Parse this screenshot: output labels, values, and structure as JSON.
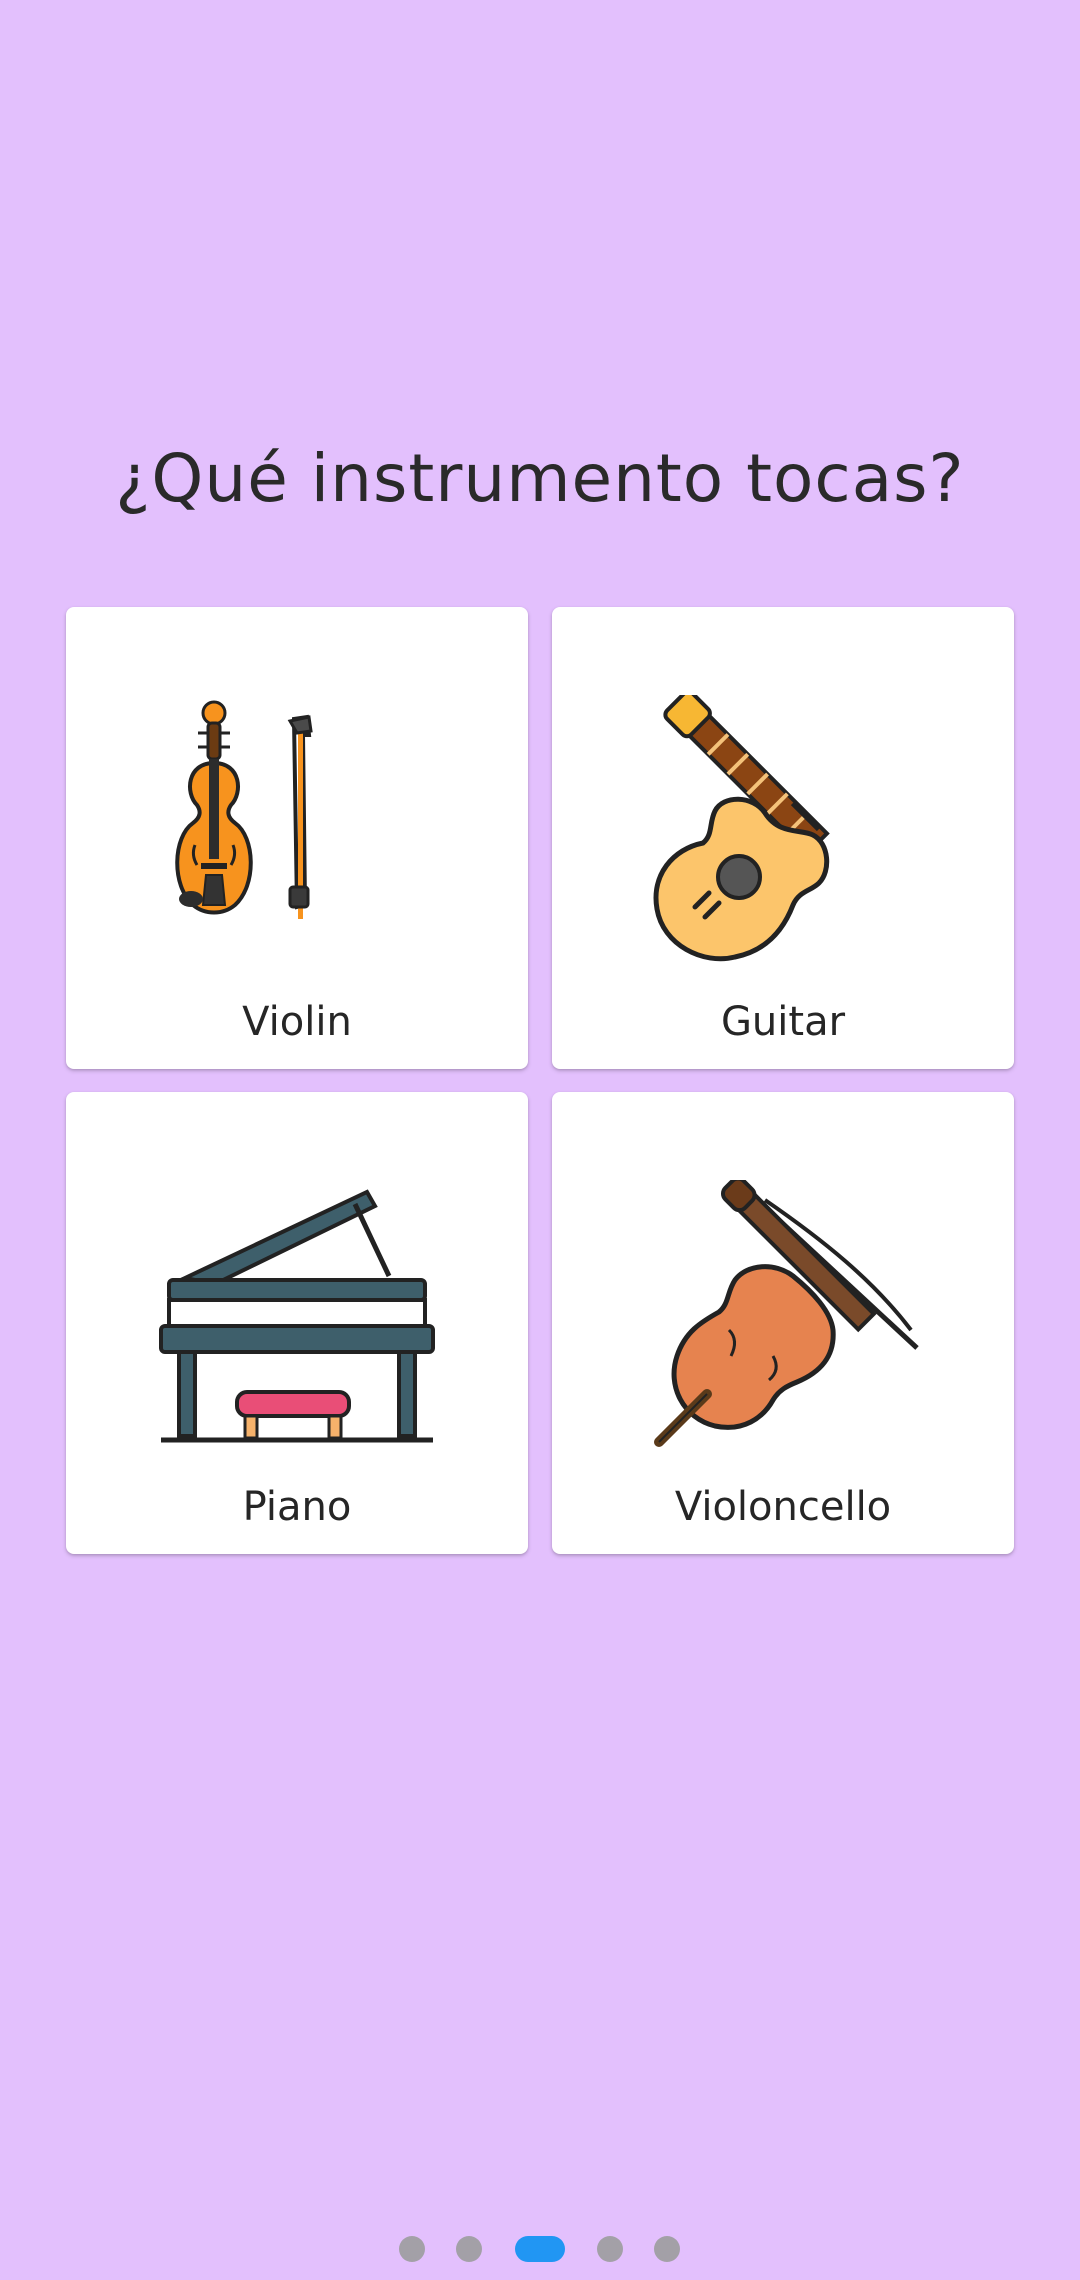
{
  "screen": {
    "question": "¿Qué instrumento tocas?"
  },
  "options": [
    {
      "id": "violin",
      "label": "Violin",
      "icon": "violin-icon"
    },
    {
      "id": "guitar",
      "label": "Guitar",
      "icon": "guitar-icon"
    },
    {
      "id": "piano",
      "label": "Piano",
      "icon": "piano-icon"
    },
    {
      "id": "cello",
      "label": "Violoncello",
      "icon": "cello-icon"
    }
  ],
  "pager": {
    "total_pages": 5,
    "current_page": 3
  },
  "colors": {
    "background": "#e3c0fd",
    "card": "#ffffff",
    "dot_inactive": "#a3a0a7",
    "dot_active": "#2196f3"
  }
}
